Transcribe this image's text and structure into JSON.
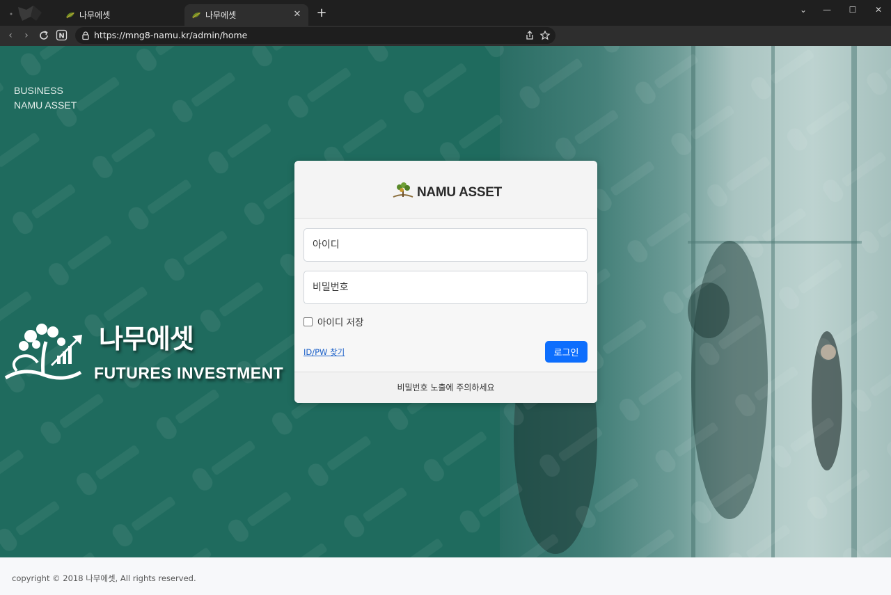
{
  "browser": {
    "tabs": [
      {
        "title": "나무에셋",
        "active": false
      },
      {
        "title": "나무에셋",
        "active": true
      }
    ],
    "new_tab_icon": "plus-icon",
    "url": "https://mng8-namu.kr/admin/home",
    "window_controls": [
      "chevron-down-icon",
      "minimize-icon",
      "maximize-icon",
      "close-icon"
    ]
  },
  "hero": {
    "brand_line1": "BUSINESS",
    "brand_line2": "NAMU ASSET",
    "brand_korean": "나무에셋",
    "brand_english": "FUTURES INVESTMENT",
    "accent_color": "#1f6b5e"
  },
  "login": {
    "title": "NAMU ASSET",
    "username_placeholder": "아이디",
    "password_placeholder": "비밀번호",
    "remember_label": "아이디 저장",
    "find_link": "ID/PW 찾기",
    "login_button": "로그인",
    "notice": "비밀번호 노출에 주의하세요",
    "button_color": "#0d6efd"
  },
  "footer": {
    "copyright": "copyright © 2018 나무에셋, All rights reserved."
  }
}
